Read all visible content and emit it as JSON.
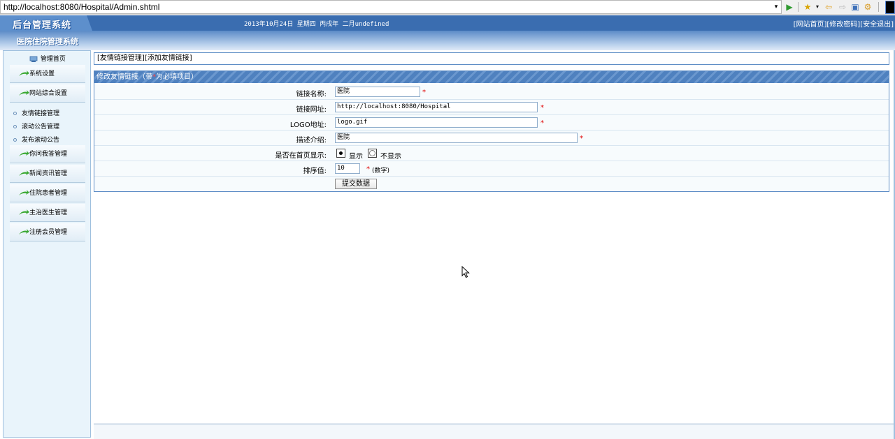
{
  "browser": {
    "url": "http://localhost:8080/Hospital/Admin.shtml",
    "icons": [
      "dropdown-icon",
      "go-icon",
      "favorites-icon",
      "back-icon",
      "forward-icon",
      "page-icon",
      "settings-icon"
    ]
  },
  "header": {
    "logo": "后台管理系统",
    "datetime": "2013年10月24日 星期四 丙戌年 二月undefined",
    "links": [
      "[网站首页]",
      "[修改密码]",
      "[安全退出]"
    ],
    "system_title": "医院住院管理系统"
  },
  "sidebar": {
    "home": "管理首页",
    "items": [
      {
        "label": "系统设置",
        "type": "button"
      },
      {
        "label": "网站综合设置",
        "type": "button"
      },
      {
        "label": "友情链接管理",
        "type": "sub"
      },
      {
        "label": "滚动公告管理",
        "type": "sub"
      },
      {
        "label": "发布滚动公告",
        "type": "sub"
      },
      {
        "label": "你问我答管理",
        "type": "button"
      },
      {
        "label": "新闻资讯管理",
        "type": "button"
      },
      {
        "label": "住院患者管理",
        "type": "button"
      },
      {
        "label": "主治医生管理",
        "type": "button"
      },
      {
        "label": "注册会员管理",
        "type": "button"
      }
    ]
  },
  "breadcrumb": {
    "link1": "[友情链接管理]",
    "link2": "[添加友情链接]"
  },
  "form": {
    "heading_pre": "修改友情链接（带",
    "heading_star": "*",
    "heading_post": "为必填项目）",
    "fields": {
      "name_label": "链接名称:",
      "name_value": "医院",
      "url_label": "链接网址:",
      "url_value": "http://localhost:8080/Hospital",
      "logo_label": "LOGO地址:",
      "logo_value": "logo.gif",
      "desc_label": "描述介绍:",
      "desc_value": "医院",
      "show_label": "是否在首页显示:",
      "show_yes": "显示",
      "show_no": "不显示",
      "sort_label": "排序值:",
      "sort_value": "10",
      "sort_hint": "(数字)"
    },
    "required_mark": "*",
    "submit": "提交数据"
  },
  "colors": {
    "banner": "#3a6db0",
    "accent": "#4f81bf",
    "required": "#e00000"
  }
}
